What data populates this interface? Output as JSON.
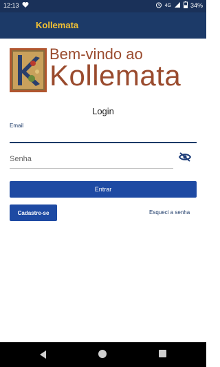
{
  "status_bar": {
    "time": "12:13",
    "network": "4G",
    "battery": "34%"
  },
  "app_bar": {
    "title": "Kollemata"
  },
  "header": {
    "welcome": "Bem-vindo ao",
    "brand": "Kollemata"
  },
  "login": {
    "title": "Login",
    "email_label": "Email",
    "email_value": "",
    "password_placeholder": "Senha",
    "enter_button": "Entrar",
    "signup_button": "Cadastre-se",
    "forgot_link": "Esqueci a senha"
  },
  "colors": {
    "app_bar": "#1c3a68",
    "accent_title": "#f4c233",
    "brand_text": "#9a4b2e",
    "button": "#1e4aa3"
  },
  "icons": [
    "heart-icon",
    "alarm-icon",
    "signal-icon",
    "battery-icon",
    "eye-off-icon",
    "back-icon",
    "home-icon",
    "recents-icon"
  ]
}
